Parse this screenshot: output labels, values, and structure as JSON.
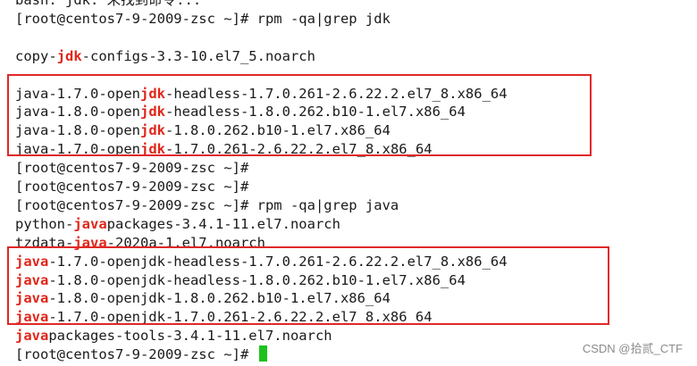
{
  "terminal": {
    "lines": [
      {
        "kind": "partial",
        "segments": [
          {
            "t": "bash: jdk: 未找到命令...",
            "hl": false
          }
        ]
      },
      {
        "kind": "prompt",
        "segments": [
          {
            "t": "[root@centos7-9-2009-zsc ~]# rpm -qa|grep jdk",
            "hl": false
          }
        ]
      },
      {
        "kind": "blank",
        "segments": []
      },
      {
        "kind": "output",
        "segments": [
          {
            "t": "copy-",
            "hl": false
          },
          {
            "t": "jdk",
            "hl": true
          },
          {
            "t": "-configs-3.3-10.el7_5.noarch",
            "hl": false
          }
        ]
      },
      {
        "kind": "blank",
        "segments": []
      },
      {
        "kind": "output",
        "segments": [
          {
            "t": "java-1.7.0-open",
            "hl": false
          },
          {
            "t": "jdk",
            "hl": true
          },
          {
            "t": "-headless-1.7.0.261-2.6.22.2.el7_8.x86_64",
            "hl": false
          }
        ]
      },
      {
        "kind": "output",
        "segments": [
          {
            "t": "java-1.8.0-open",
            "hl": false
          },
          {
            "t": "jdk",
            "hl": true
          },
          {
            "t": "-headless-1.8.0.262.b10-1.el7.x86_64",
            "hl": false
          }
        ]
      },
      {
        "kind": "output",
        "segments": [
          {
            "t": "java-1.8.0-open",
            "hl": false
          },
          {
            "t": "jdk",
            "hl": true
          },
          {
            "t": "-1.8.0.262.b10-1.el7.x86_64",
            "hl": false
          }
        ]
      },
      {
        "kind": "output",
        "segments": [
          {
            "t": "java-1.7.0-open",
            "hl": false
          },
          {
            "t": "jdk",
            "hl": true
          },
          {
            "t": "-1.7.0.261-2.6.22.2.el7_8.x86_64",
            "hl": false
          }
        ]
      },
      {
        "kind": "prompt",
        "segments": [
          {
            "t": "[root@centos7-9-2009-zsc ~]#",
            "hl": false
          }
        ]
      },
      {
        "kind": "prompt",
        "segments": [
          {
            "t": "[root@centos7-9-2009-zsc ~]#",
            "hl": false
          }
        ]
      },
      {
        "kind": "prompt",
        "segments": [
          {
            "t": "[root@centos7-9-2009-zsc ~]# rpm -qa|grep java",
            "hl": false
          }
        ]
      },
      {
        "kind": "output",
        "segments": [
          {
            "t": "python-",
            "hl": false
          },
          {
            "t": "java",
            "hl": true
          },
          {
            "t": "packages-3.4.1-11.el7.noarch",
            "hl": false
          }
        ]
      },
      {
        "kind": "output",
        "segments": [
          {
            "t": "tzdata-",
            "hl": false
          },
          {
            "t": "java",
            "hl": true
          },
          {
            "t": "-2020a-1.el7.noarch",
            "hl": false
          }
        ]
      },
      {
        "kind": "output",
        "segments": [
          {
            "t": "java",
            "hl": true
          },
          {
            "t": "-1.7.0-openjdk-headless-1.7.0.261-2.6.22.2.el7_8.x86_64",
            "hl": false
          }
        ]
      },
      {
        "kind": "output",
        "segments": [
          {
            "t": "java",
            "hl": true
          },
          {
            "t": "-1.8.0-openjdk-headless-1.8.0.262.b10-1.el7.x86_64",
            "hl": false
          }
        ]
      },
      {
        "kind": "output",
        "segments": [
          {
            "t": "java",
            "hl": true
          },
          {
            "t": "-1.8.0-openjdk-1.8.0.262.b10-1.el7.x86_64",
            "hl": false
          }
        ]
      },
      {
        "kind": "output",
        "segments": [
          {
            "t": "java",
            "hl": true
          },
          {
            "t": "-1.7.0-openjdk-1.7.0.261-2.6.22.2.el7_8.x86_64",
            "hl": false
          }
        ]
      },
      {
        "kind": "output",
        "segments": [
          {
            "t": "java",
            "hl": true
          },
          {
            "t": "packages-tools-3.4.1-11.el7.noarch",
            "hl": false
          }
        ]
      },
      {
        "kind": "prompt-cursor",
        "segments": [
          {
            "t": "[root@centos7-9-2009-zsc ~]# ",
            "hl": false
          }
        ]
      }
    ]
  },
  "colors": {
    "background": "#ffffff",
    "text": "#1a1a1a",
    "highlight": "#e0261a",
    "box_border": "#e02828",
    "cursor": "#1ec21e",
    "watermark": "#8a8a8a"
  },
  "watermark": {
    "text": "CSDN @拾贰_CTF"
  }
}
